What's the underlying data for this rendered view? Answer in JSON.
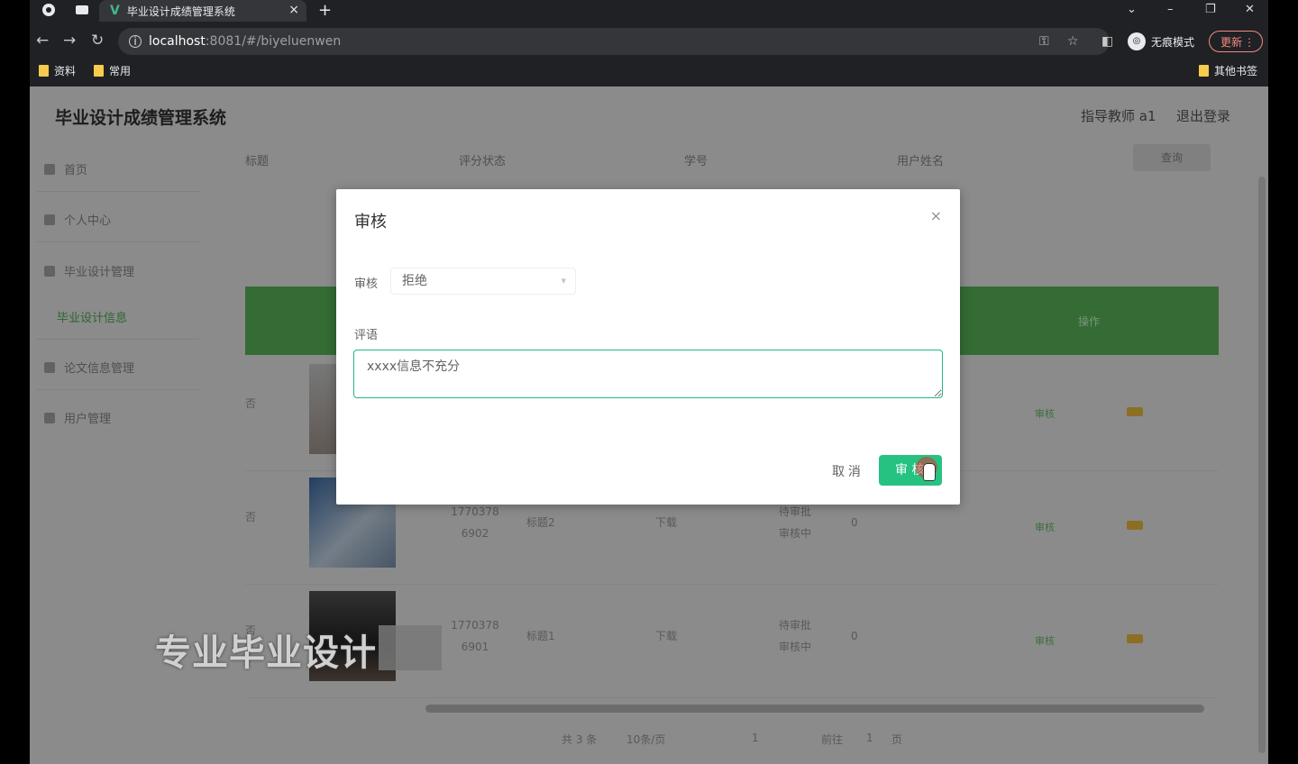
{
  "browser": {
    "tab_title": "毕业设计成绩管理系统",
    "tab_close": "×",
    "new_tab": "+",
    "back": "←",
    "forward": "→",
    "reload": "↻",
    "url_host": "localhost",
    "url_path": ":8081/#/biyeluenwen",
    "incognito_label": "无痕模式",
    "update_label": "更新",
    "menu": "⋮",
    "bookmarks": [
      "资料",
      "常用"
    ],
    "other_bookmarks": "其他书签",
    "window_controls": [
      "⌄",
      "–",
      "❐",
      "✕"
    ],
    "toolbar_icons": [
      "key-icon",
      "star-icon",
      "sidepanel-icon"
    ]
  },
  "app": {
    "title": "毕业设计成绩管理系统",
    "role": "指导教师 a1",
    "logout": "退出登录"
  },
  "sidebar": {
    "items": [
      {
        "label": "首页",
        "icon": "home-icon"
      },
      {
        "label": "个人中心",
        "icon": "user-icon"
      },
      {
        "label": "毕业设计管理",
        "icon": "doc-icon"
      },
      {
        "label": "论文信息管理",
        "icon": "chart-icon"
      },
      {
        "label": "用户管理",
        "icon": "users-icon"
      }
    ],
    "sub_label": "毕业设计信息"
  },
  "table": {
    "headers": [
      "标题",
      "评分状态",
      "学号",
      "用户姓名"
    ],
    "search_button": "查询",
    "rows": [
      {
        "mark": "否",
        "col1": "",
        "col2": "",
        "col3": "",
        "col4": "",
        "col5": ""
      },
      {
        "mark": "否",
        "col1": "1770378\n6902",
        "col2": "标题2",
        "col3": "下载",
        "col4": "待审批\n审核中",
        "col5": "0"
      },
      {
        "mark": "否",
        "col1": "1770378\n6901",
        "col2": "标题1",
        "col3": "下载",
        "col4": "待审批\n审核中",
        "col5": "0"
      }
    ],
    "row_action": "审核"
  },
  "pager": {
    "total": "共 3 条",
    "per_page": "10条/页",
    "current": "1",
    "goto": "前往",
    "page_input": "1",
    "page_unit": "页"
  },
  "dialog": {
    "title": "审核",
    "close": "×",
    "status_label": "审核",
    "status_value": "拒绝",
    "comment_label": "评语",
    "comment_value": "xxxx信息不充分",
    "cancel": "取 消",
    "confirm": "审 核"
  },
  "watermark": "专业毕业设计"
}
